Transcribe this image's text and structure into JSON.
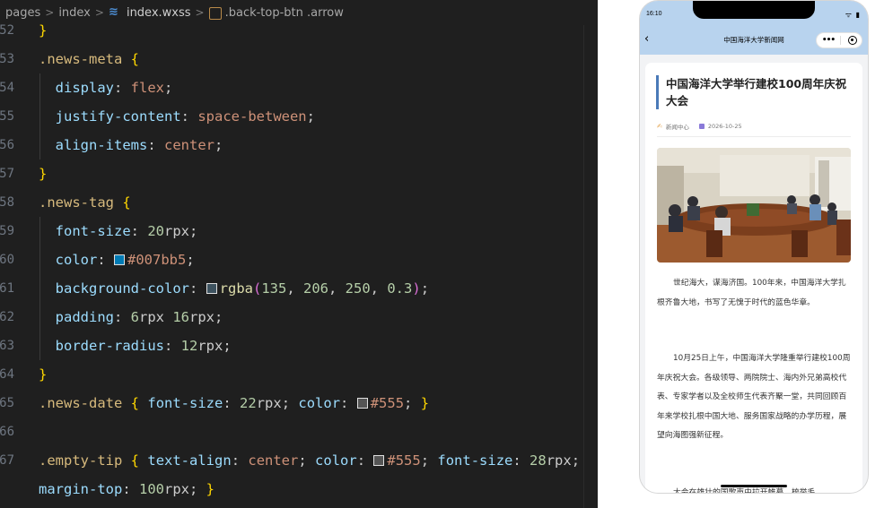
{
  "breadcrumb": {
    "items": [
      "pages",
      "index",
      "index.wxss",
      ".back-top-btn .arrow"
    ]
  },
  "code_lines": [
    {
      "n": "52",
      "tokens": [
        [
          "t-brace",
          "}"
        ]
      ]
    },
    {
      "n": "53",
      "tokens": [
        [
          "t-sel",
          ".news-meta"
        ],
        [
          "t-plain",
          " "
        ],
        [
          "t-brace",
          "{"
        ]
      ]
    },
    {
      "n": "54",
      "tokens": [
        [
          "t-plain",
          "  "
        ],
        [
          "t-prop",
          "display"
        ],
        [
          "t-plain",
          ": "
        ],
        [
          "t-val",
          "flex"
        ],
        [
          "t-plain",
          ";"
        ]
      ]
    },
    {
      "n": "55",
      "tokens": [
        [
          "t-plain",
          "  "
        ],
        [
          "t-prop",
          "justify-content"
        ],
        [
          "t-plain",
          ": "
        ],
        [
          "t-val",
          "space-between"
        ],
        [
          "t-plain",
          ";"
        ]
      ]
    },
    {
      "n": "56",
      "tokens": [
        [
          "t-plain",
          "  "
        ],
        [
          "t-prop",
          "align-items"
        ],
        [
          "t-plain",
          ": "
        ],
        [
          "t-val",
          "center"
        ],
        [
          "t-plain",
          ";"
        ]
      ]
    },
    {
      "n": "57",
      "tokens": [
        [
          "t-brace",
          "}"
        ]
      ]
    },
    {
      "n": "58",
      "tokens": [
        [
          "t-sel",
          ".news-tag"
        ],
        [
          "t-plain",
          " "
        ],
        [
          "t-brace",
          "{"
        ]
      ]
    },
    {
      "n": "59",
      "tokens": [
        [
          "t-plain",
          "  "
        ],
        [
          "t-prop",
          "font-size"
        ],
        [
          "t-plain",
          ": "
        ],
        [
          "t-num",
          "20"
        ],
        [
          "t-unit",
          "rpx"
        ],
        [
          "t-plain",
          ";"
        ]
      ]
    },
    {
      "n": "60",
      "tokens": [
        [
          "t-plain",
          "  "
        ],
        [
          "t-prop",
          "color"
        ],
        [
          "t-plain",
          ": "
        ],
        [
          "swatch",
          "#007bb5"
        ],
        [
          "t-val",
          "#007bb5"
        ],
        [
          "t-plain",
          ";"
        ]
      ]
    },
    {
      "n": "61",
      "tokens": [
        [
          "t-plain",
          "  "
        ],
        [
          "t-prop",
          "background-color"
        ],
        [
          "t-plain",
          ": "
        ],
        [
          "swatch",
          "rgba(135,206,250,0.3)"
        ],
        [
          "t-fn",
          "rgba"
        ],
        [
          "t-paren",
          "("
        ],
        [
          "t-num",
          "135"
        ],
        [
          "t-plain",
          ", "
        ],
        [
          "t-num",
          "206"
        ],
        [
          "t-plain",
          ", "
        ],
        [
          "t-num",
          "250"
        ],
        [
          "t-plain",
          ", "
        ],
        [
          "t-num",
          "0.3"
        ],
        [
          "t-paren",
          ")"
        ],
        [
          "t-plain",
          ";"
        ]
      ]
    },
    {
      "n": "62",
      "tokens": [
        [
          "t-plain",
          "  "
        ],
        [
          "t-prop",
          "padding"
        ],
        [
          "t-plain",
          ": "
        ],
        [
          "t-num",
          "6"
        ],
        [
          "t-unit",
          "rpx "
        ],
        [
          "t-num",
          "16"
        ],
        [
          "t-unit",
          "rpx"
        ],
        [
          "t-plain",
          ";"
        ]
      ]
    },
    {
      "n": "63",
      "tokens": [
        [
          "t-plain",
          "  "
        ],
        [
          "t-prop",
          "border-radius"
        ],
        [
          "t-plain",
          ": "
        ],
        [
          "t-num",
          "12"
        ],
        [
          "t-unit",
          "rpx"
        ],
        [
          "t-plain",
          ";"
        ]
      ]
    },
    {
      "n": "64",
      "tokens": [
        [
          "t-brace",
          "}"
        ]
      ]
    },
    {
      "n": "65",
      "tokens": [
        [
          "t-sel",
          ".news-date"
        ],
        [
          "t-plain",
          " "
        ],
        [
          "t-brace",
          "{"
        ],
        [
          "t-plain",
          " "
        ],
        [
          "t-prop",
          "font-size"
        ],
        [
          "t-plain",
          ": "
        ],
        [
          "t-num",
          "22"
        ],
        [
          "t-unit",
          "rpx"
        ],
        [
          "t-plain",
          "; "
        ],
        [
          "t-prop",
          "color"
        ],
        [
          "t-plain",
          ": "
        ],
        [
          "swatch",
          "#555"
        ],
        [
          "t-val",
          "#555"
        ],
        [
          "t-plain",
          "; "
        ],
        [
          "t-brace",
          "}"
        ]
      ]
    },
    {
      "n": "66",
      "tokens": []
    },
    {
      "n": "67",
      "tokens": [
        [
          "t-sel",
          ".empty-tip"
        ],
        [
          "t-plain",
          " "
        ],
        [
          "t-brace",
          "{"
        ],
        [
          "t-plain",
          " "
        ],
        [
          "t-prop",
          "text-align"
        ],
        [
          "t-plain",
          ": "
        ],
        [
          "t-val",
          "center"
        ],
        [
          "t-plain",
          "; "
        ],
        [
          "t-prop",
          "color"
        ],
        [
          "t-plain",
          ": "
        ],
        [
          "swatch",
          "#555"
        ],
        [
          "t-val",
          "#555"
        ],
        [
          "t-plain",
          "; "
        ],
        [
          "t-prop",
          "font-size"
        ],
        [
          "t-plain",
          ": "
        ],
        [
          "t-num",
          "28"
        ],
        [
          "t-unit",
          "rpx"
        ],
        [
          "t-plain",
          ";"
        ]
      ]
    },
    {
      "n": "",
      "tokens": [
        [
          "t-prop",
          "margin-top"
        ],
        [
          "t-plain",
          ": "
        ],
        [
          "t-num",
          "100"
        ],
        [
          "t-unit",
          "rpx"
        ],
        [
          "t-plain",
          "; "
        ],
        [
          "t-brace",
          "}"
        ]
      ]
    }
  ],
  "phone": {
    "time": "16:10",
    "status_icons": "ᯤ ▮",
    "nav_back_icon": "chevron-left-icon",
    "nav_title": "中国海洋大学新闻网",
    "capsule_more": "•••",
    "article": {
      "title": "中国海洋大学举行建校100周年庆祝大会",
      "source": "新闻中心",
      "date": "2026-10-25",
      "para1": "世纪海大，谋海济国。100年来，中国海洋大学扎根齐鲁大地，书写了无愧于时代的蓝色华章。",
      "para2": "10月25日上午，中国海洋大学隆重举行建校100周年庆祝大会。各级领导、两院院士、海内外兄弟高校代表、专家学者以及全校师生代表齐聚一堂，共同回顾百年来学校扎根中国大地、服务国家战略的办学历程，展望向海图强新征程。",
      "para3": "大会在雄壮的国歌声中拉开帷幕，梳举毛"
    }
  }
}
